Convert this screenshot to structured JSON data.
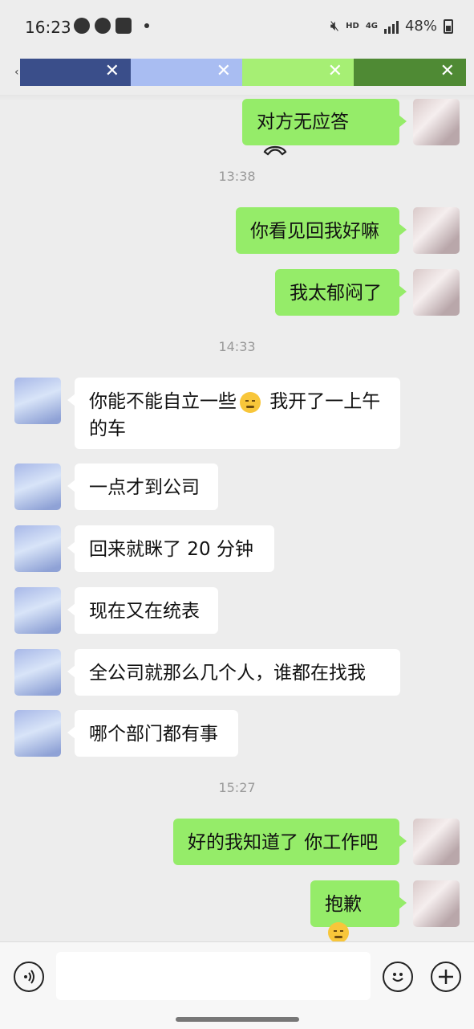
{
  "status_bar": {
    "time": "16:23",
    "network_label": "HD",
    "network_type": "4G",
    "battery": "48%"
  },
  "tab_colors": [
    "#3a4e8a",
    "#a9bdf2",
    "#a6ef74",
    "#4f8a34"
  ],
  "close_glyph": "✕",
  "back_glyph": "‹",
  "messages": [
    {
      "from": "me",
      "text": "对方无应答",
      "icon": "phone-hangup-icon"
    },
    {
      "type": "time",
      "text": "13:38"
    },
    {
      "from": "me",
      "text": "你看见回我好嘛"
    },
    {
      "from": "me",
      "text": "我太郁闷了"
    },
    {
      "type": "time",
      "text": "14:33"
    },
    {
      "from": "them",
      "text_a": "你能不能自立一些",
      "text_b": " 我开了一上午的车",
      "emoji": "sleepy-face-emoji"
    },
    {
      "from": "them",
      "text": "一点才到公司"
    },
    {
      "from": "them",
      "text": "回来就眯了 20 分钟"
    },
    {
      "from": "them",
      "text": "现在又在统表"
    },
    {
      "from": "them",
      "text": "全公司就那么几个人，谁都在找我"
    },
    {
      "from": "them",
      "text": "哪个部门都有事"
    },
    {
      "type": "time",
      "text": "15:27"
    },
    {
      "from": "me",
      "text": "好的我知道了 你工作吧"
    },
    {
      "from": "me",
      "text": "抱歉",
      "emoji": "laughing-tears-emoji"
    }
  ],
  "input": {
    "placeholder": "",
    "value": ""
  },
  "colors": {
    "my_bubble": "#95ec69",
    "their_bubble": "#ffffff",
    "background": "#ededed"
  }
}
